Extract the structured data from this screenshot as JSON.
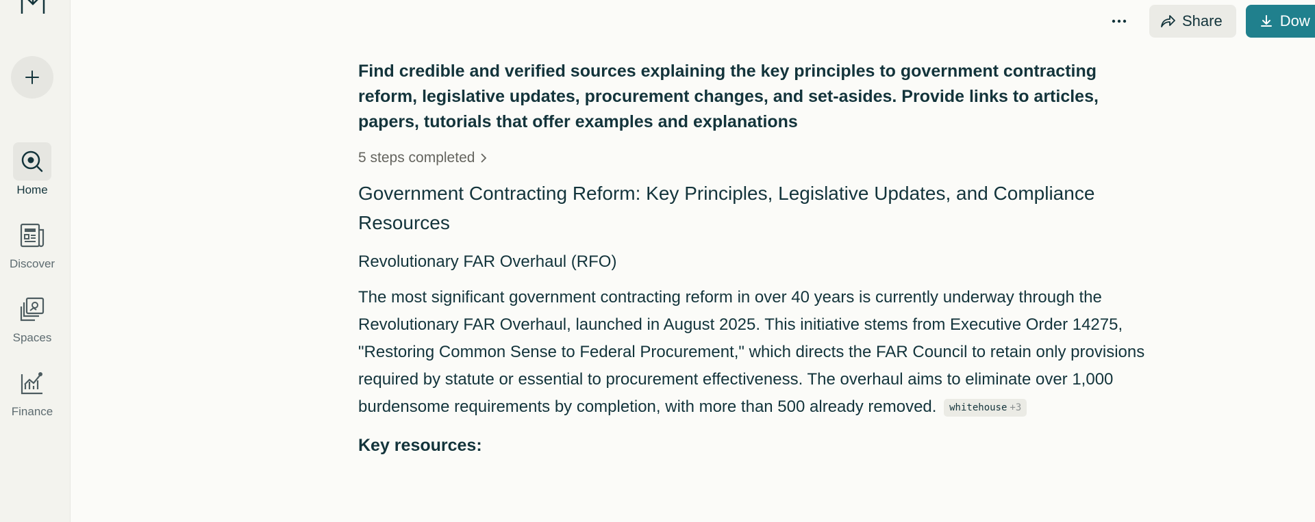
{
  "sidebar": {
    "items": [
      {
        "label": "Home",
        "icon": "home-search-icon",
        "active": true
      },
      {
        "label": "Discover",
        "icon": "newspaper-icon"
      },
      {
        "label": "Spaces",
        "icon": "spaces-icon"
      },
      {
        "label": "Finance",
        "icon": "finance-chart-icon"
      }
    ]
  },
  "header": {
    "share_label": "Share",
    "download_label": "Dow"
  },
  "main": {
    "query": "Find credible and verified sources explaining the key principles to government contracting reform, legislative updates, procurement changes, and set-asides. Provide links to articles, papers, tutorials that offer examples and explanations",
    "steps": "5 steps completed",
    "title": "Government Contracting Reform: Key Principles, Legislative Updates, and Compliance Resources",
    "section_title": "Revolutionary FAR Overhaul (RFO)",
    "paragraph": "The most significant government contracting reform in over 40 years is currently underway through the Revolutionary FAR Overhaul, launched in August 2025. This initiative stems from Executive Order 14275, \"Restoring Common Sense to Federal Procurement,\" which directs the FAR Council to retain only provisions required by statute or essential to procurement effectiveness. The overhaul aims to eliminate over 1,000 burdensome requirements by completion, with more than 500 already removed.",
    "citation_source": "whitehouse",
    "citation_more": "+3",
    "resources_heading": "Key resources:"
  },
  "colors": {
    "accent": "#20808d",
    "text": "#13343b",
    "background": "#fbfbf8",
    "sidebar": "#f3f3ee"
  }
}
